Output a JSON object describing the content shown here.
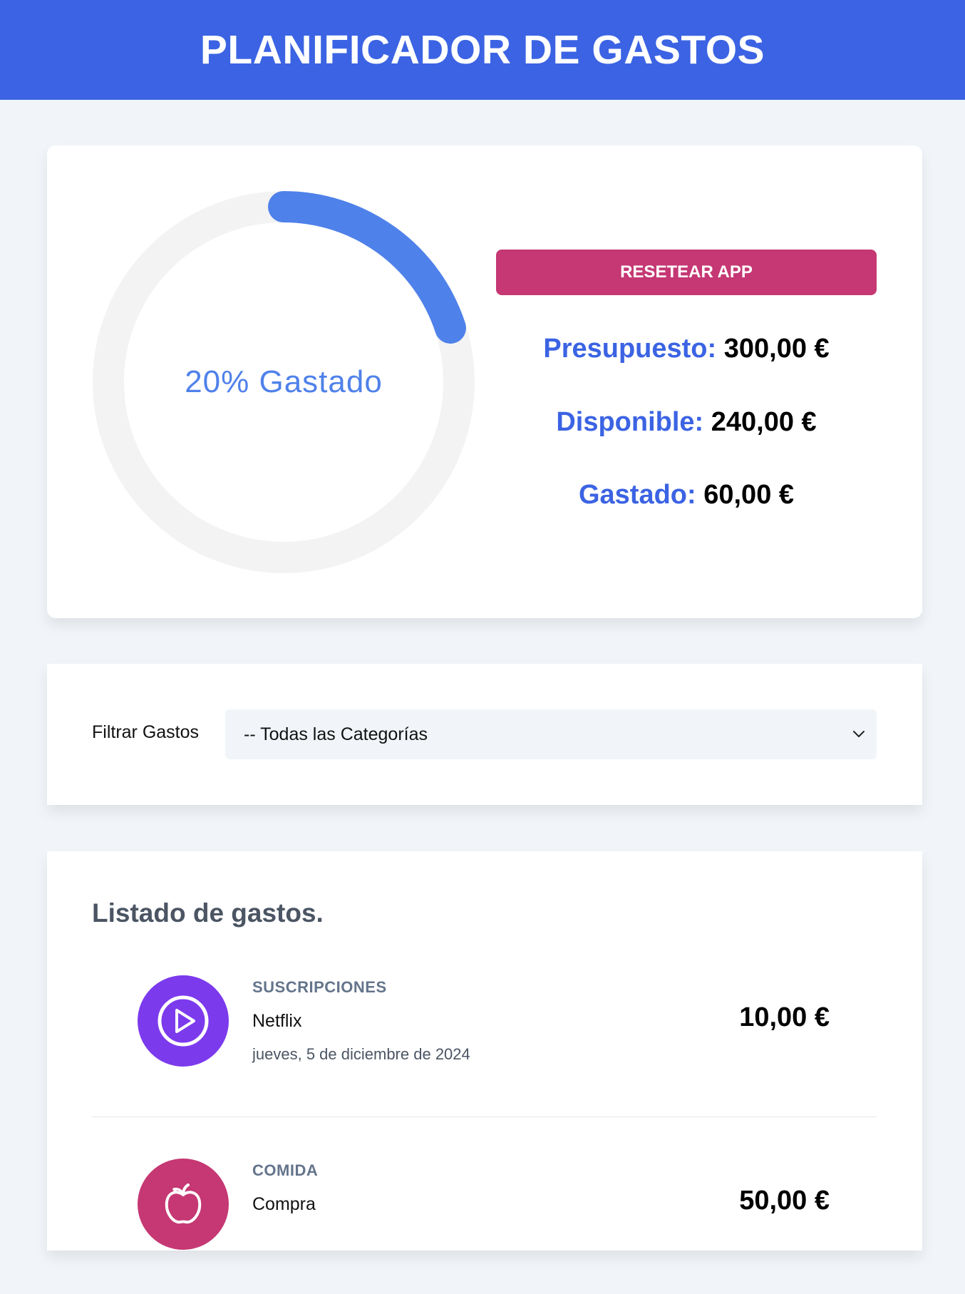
{
  "header": {
    "title": "PLANIFICADOR DE GASTOS"
  },
  "budget": {
    "progress_label": "20% Gastado",
    "percent_spent": 20,
    "colors": {
      "track": "#f3f3f3",
      "fill": "#4f81ea"
    },
    "reset_label": "RESETEAR APP",
    "presupuesto_label": "Presupuesto:",
    "presupuesto_value": "300,00 €",
    "disponible_label": "Disponible:",
    "disponible_value": "240,00 €",
    "gastado_label": "Gastado:",
    "gastado_value": "60,00 €"
  },
  "filter": {
    "label": "Filtrar Gastos",
    "selected": "-- Todas las Categorías"
  },
  "list": {
    "title": "Listado de gastos.",
    "expenses": [
      {
        "category": "SUSCRIPCIONES",
        "name": "Netflix",
        "date": "jueves, 5 de diciembre de 2024",
        "amount": "10,00 €",
        "icon": "play-icon",
        "color": "#7c3aed"
      },
      {
        "category": "COMIDA",
        "name": "Compra",
        "date": "",
        "amount": "50,00 €",
        "icon": "apple-icon",
        "color": "#c53873"
      }
    ]
  },
  "theme": {
    "primary": "#3b63e3",
    "danger": "#c53873",
    "background": "#f1f5f9"
  }
}
